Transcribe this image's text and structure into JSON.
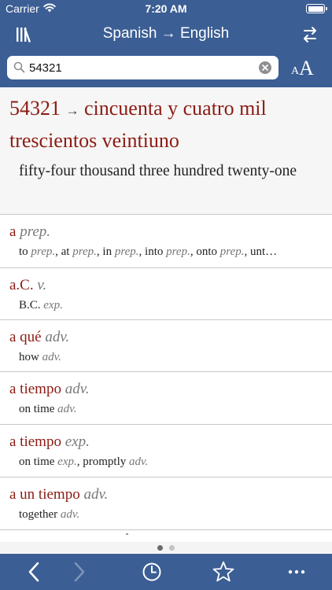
{
  "status_bar": {
    "carrier": "Carrier",
    "time": "7:20 AM"
  },
  "nav": {
    "title": "Spanish → English"
  },
  "search": {
    "value": "54321"
  },
  "font_size": {
    "small": "A",
    "large": "A"
  },
  "result": {
    "number": "54321",
    "arrow": "→",
    "spanish": "cincuenta y cuatro mil trescientos veintiuno",
    "english": "fifty-four thousand three hundred twenty-one"
  },
  "entries": [
    {
      "word": "a",
      "pos": "prep.",
      "sub": [
        {
          "t": "to ",
          "p": "prep."
        },
        {
          "t": ", at ",
          "p": "prep."
        },
        {
          "t": ", in ",
          "p": "prep."
        },
        {
          "t": ", into ",
          "p": "prep."
        },
        {
          "t": ", onto ",
          "p": "prep."
        },
        {
          "t": ", unt…",
          "p": ""
        }
      ]
    },
    {
      "word": "a.C.",
      "pos": "v.",
      "sub": [
        {
          "t": "B.C. ",
          "p": "exp."
        }
      ]
    },
    {
      "word": "a qué",
      "pos": "adv.",
      "sub": [
        {
          "t": "how ",
          "p": "adv."
        }
      ]
    },
    {
      "word": "a tiempo",
      "pos": "adv.",
      "sub": [
        {
          "t": "on time ",
          "p": "adv."
        }
      ]
    },
    {
      "word": "a tiempo",
      "pos": "exp.",
      "sub": [
        {
          "t": "on time ",
          "p": "exp."
        },
        {
          "t": ", promptly ",
          "p": "adv."
        }
      ]
    },
    {
      "word": "a un tiempo",
      "pos": "adv.",
      "sub": [
        {
          "t": "together ",
          "p": "adv."
        }
      ]
    }
  ],
  "page_indicator": {
    "current": 1,
    "total": 2
  },
  "icons": {
    "library": "library-icon",
    "swap": "swap-direction-icon",
    "search": "search-icon",
    "clear": "clear-icon",
    "back": "chevron-left-icon",
    "forward": "chevron-right-icon",
    "history": "clock-icon",
    "favorites": "star-icon",
    "more": "more-icon"
  },
  "colors": {
    "bar": "#3b5e94",
    "headword": "#8c1b13",
    "pos": "#777777"
  }
}
